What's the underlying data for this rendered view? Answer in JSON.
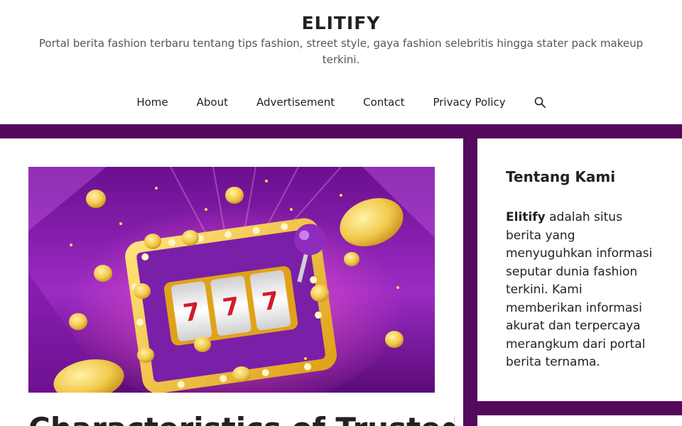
{
  "site": {
    "title": "ELITIFY",
    "description": "Portal berita fashion terbaru tentang tips fashion, street style, gaya fashion selebritis hingga stater pack makeup terkini."
  },
  "nav": {
    "items": [
      {
        "label": "Home"
      },
      {
        "label": "About"
      },
      {
        "label": "Advertisement"
      },
      {
        "label": "Contact"
      },
      {
        "label": "Privacy Policy"
      }
    ],
    "search_icon": "search-icon"
  },
  "article": {
    "image_alt_icon": "slot-machine-illustration",
    "title": "Characteristics of Trusted"
  },
  "sidebar": {
    "widget_title": "Tentang Kami",
    "brand": "Elitify",
    "text": " adalah situs berita yang menyuguhkan informasi seputar dunia fashion terkini. Kami memberikan informasi akurat dan terpercaya merangkum dari portal berita ternama."
  },
  "colors": {
    "background": "#540a5c",
    "accent_purple": "#7b1fa2",
    "gold": "#f2c94c"
  }
}
